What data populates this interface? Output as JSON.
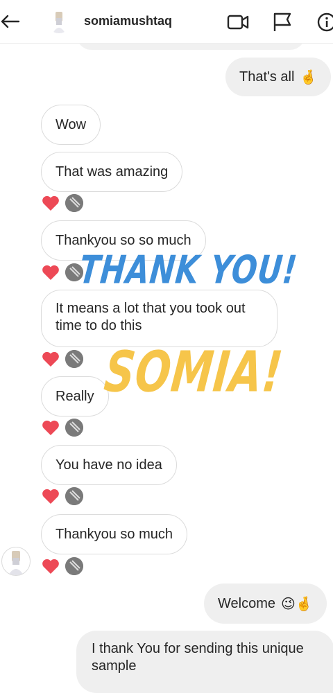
{
  "header": {
    "username": "somiamushtaq",
    "icons": [
      "back-arrow-icon",
      "video-call-icon",
      "flag-icon",
      "info-icon"
    ]
  },
  "messages": {
    "sent_1": {
      "text": "That's all",
      "emoji": "🤞"
    },
    "recv_1": "Wow",
    "recv_2": "That was amazing",
    "recv_3": "Thankyou so so much",
    "recv_4": "It means a lot that you took out time to do this",
    "recv_5": "Really",
    "recv_6": "You have no idea",
    "recv_7": "Thankyou so much",
    "sent_2": {
      "text": "Welcome",
      "emoji": "😉🤞"
    },
    "sent_3": "I thank You for sending this unique sample"
  },
  "stickers": {
    "thank_you": "THANK YOU!",
    "somia": "SOMIA!"
  },
  "reactions": {
    "heart_color": "#ed4956"
  },
  "colors": {
    "sticker_blue": "#3d8ed9",
    "sticker_yellow": "#f6c54a",
    "sent_bg": "#efefef",
    "recv_border": "#dbdbdb"
  }
}
